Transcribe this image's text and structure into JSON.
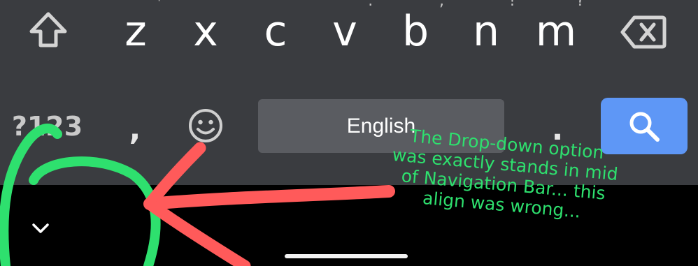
{
  "keyboard": {
    "row3_letters": [
      "z",
      "x",
      "c",
      "v",
      "b",
      "n",
      "m"
    ],
    "hint_chars": [
      "*",
      "\"",
      "'",
      ":",
      ";",
      "!",
      "?"
    ],
    "bottom_row": {
      "symbols_label": "?123",
      "comma_label": ",",
      "spacebar_label": "English",
      "period_label": "."
    },
    "accent_color": "#5e97f6",
    "key_bg_color": "#3a3c40"
  },
  "navbar": {
    "collapse_icon": "chevron-down-icon"
  },
  "annotation": {
    "text": "The Drop-down option was exactly stands in mid of Navigation Bar... this align was wrong...",
    "text_color": "#2ee06e",
    "arrow_color": "#ff5a5a"
  }
}
